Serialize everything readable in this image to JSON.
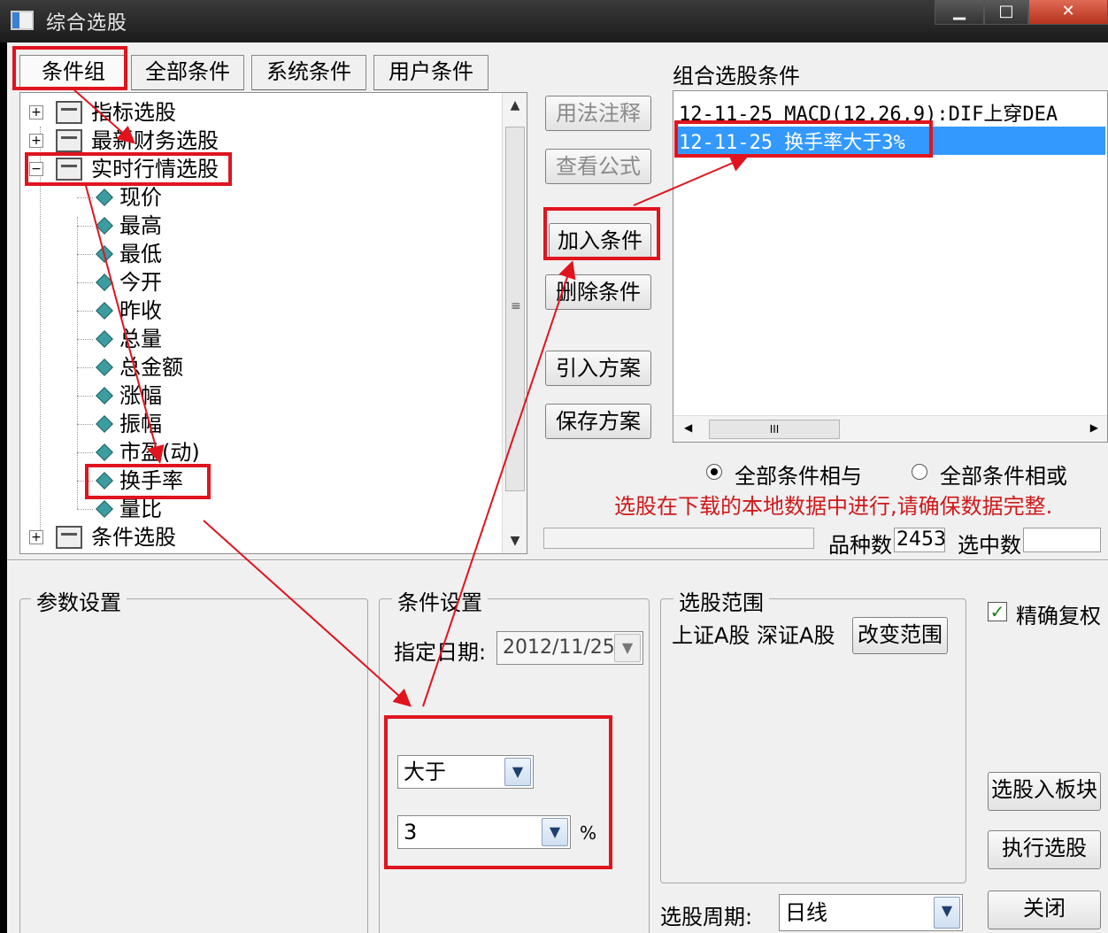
{
  "window": {
    "title": "综合选股",
    "min": "▁",
    "max": "□",
    "close": "✕"
  },
  "tabs": [
    {
      "label": "条件组",
      "selected": true
    },
    {
      "label": "全部条件"
    },
    {
      "label": "系统条件"
    },
    {
      "label": "用户条件"
    }
  ],
  "tree": {
    "nodes": [
      {
        "label": "指标选股",
        "expander": "+"
      },
      {
        "label": "最新财务选股",
        "expander": "+"
      },
      {
        "label": "实时行情选股",
        "expander": "−"
      },
      {
        "label": "条件选股",
        "expander": "+"
      }
    ],
    "children": [
      "现价",
      "最高",
      "最低",
      "今开",
      "昨收",
      "总量",
      "总金额",
      "涨幅",
      "振幅",
      "市盈(动)",
      "换手率",
      "量比"
    ],
    "scroll_up": "▲",
    "scroll_down": "▼",
    "scroll_grip": "≡"
  },
  "buttons": {
    "usage": "用法注释",
    "formula": "查看公式",
    "add": "加入条件",
    "delete": "删除条件",
    "import": "引入方案",
    "save": "保存方案",
    "change_range": "改变范围",
    "to_block": "选股入板块",
    "execute": "执行选股",
    "close": "关闭"
  },
  "combined": {
    "title": "组合选股条件",
    "items": [
      {
        "text": "12-11-25 MACD(12,26,9):DIF上穿DEA"
      },
      {
        "text": "12-11-25 换手率大于3%"
      }
    ],
    "scroll_left": "◀",
    "scroll_right": "▶",
    "scroll_thumb": "III"
  },
  "logic": {
    "and_label": "全部条件相与",
    "or_label": "全部条件相或",
    "selected": "and"
  },
  "warning": "选股在下载的本地数据中进行,请确保数据完整.",
  "stats": {
    "count_label": "品种数",
    "count_value": "2453",
    "selected_label": "选中数",
    "selected_value": ""
  },
  "params": {
    "title": "参数设置"
  },
  "condition": {
    "title": "条件设置",
    "date_label": "指定日期:",
    "date_value": "2012/11/25",
    "operator": "大于",
    "value": "3",
    "unit": "%",
    "dropdown_icon": "▼"
  },
  "range": {
    "title": "选股范围",
    "text": "上证A股 深证A股"
  },
  "exact": {
    "label": "精确复权",
    "checked": true,
    "mark": "✓"
  },
  "period": {
    "label": "选股周期:",
    "value": "日线"
  },
  "colors": {
    "annotation": "#e0141e",
    "selection": "#3399ff",
    "warning": "#d0181a"
  }
}
